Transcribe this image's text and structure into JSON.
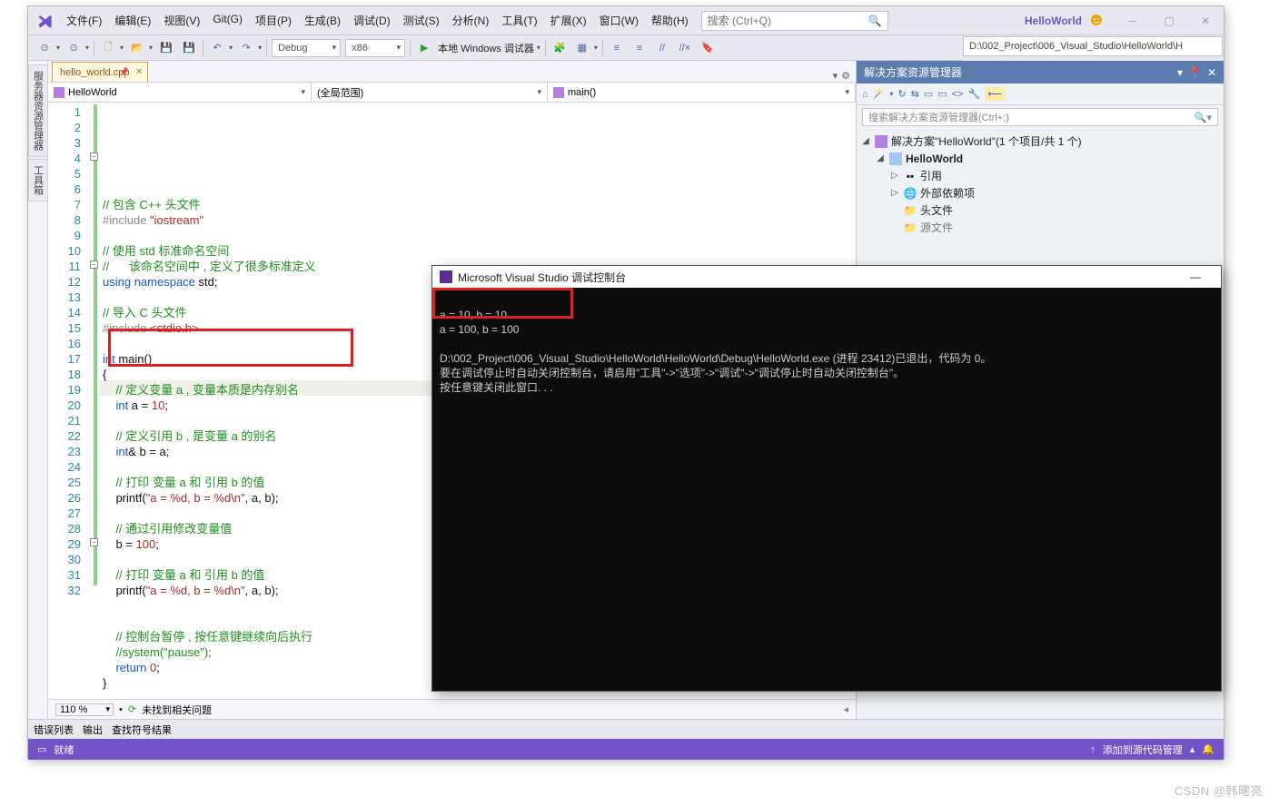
{
  "title_project": "HelloWorld",
  "path_display": "D:\\002_Project\\006_Visual_Studio\\HelloWorld\\H",
  "menus": [
    "文件(F)",
    "编辑(E)",
    "视图(V)",
    "Git(G)",
    "项目(P)",
    "生成(B)",
    "调试(D)",
    "测试(S)",
    "分析(N)",
    "工具(T)",
    "扩展(X)",
    "窗口(W)",
    "帮助(H)"
  ],
  "search_placeholder": "搜索 (Ctrl+Q)",
  "config_combo": "Debug",
  "platform_combo": "x86",
  "run_label": "本地 Windows 调试器",
  "file_tab": "hello_world.cpp",
  "nav1": "HelloWorld",
  "nav2": "(全局范围)",
  "nav3": "main()",
  "sidetabs": [
    "服务器资源管理器",
    "工具箱"
  ],
  "code_lines": [
    "// 包含 C++ 头文件",
    "#include \"iostream\"",
    "",
    "// 使用 std 标准命名空间",
    "//      该命名空间中 , 定义了很多标准定义",
    "using namespace std;",
    "",
    "// 导入 C 头文件",
    "#include <stdio.h>",
    "",
    "int main()",
    "{",
    "    // 定义变量 a , 变量本质是内存别名",
    "    int a = 10;",
    "",
    "    // 定义引用 b , 是变量 a 的别名",
    "    int& b = a;",
    "",
    "    // 打印 变量 a 和 引用 b 的值",
    "    printf(\"a = %d, b = %d\\n\", a, b);",
    "",
    "    // 通过引用修改变量值",
    "    b = 100;",
    "",
    "    // 打印 变量 a 和 引用 b 的值",
    "    printf(\"a = %d, b = %d\\n\", a, b);",
    "",
    "",
    "    // 控制台暂停 , 按任意键继续向后执行",
    "    //system(\"pause\");",
    "    return 0;",
    "}"
  ],
  "zoom": "110 %",
  "issue_text": "未找到相关问题",
  "bottom_tabs": [
    "错误列表",
    "输出",
    "查找符号结果"
  ],
  "status_text": "就绪",
  "status_right": "添加到源代码管理",
  "solution": {
    "title": "解决方案资源管理器",
    "search_placeholder": "搜索解决方案资源管理器(Ctrl+;)",
    "root": "解决方案\"HelloWorld\"(1 个项目/共 1 个)",
    "project": "HelloWorld",
    "nodes": [
      "引用",
      "外部依赖项",
      "头文件",
      "源文件"
    ]
  },
  "console": {
    "title": "Microsoft Visual Studio 调试控制台",
    "out1": "a = 10, b = 10",
    "out2": "a = 100, b = 100",
    "exit": "D:\\002_Project\\006_Visual_Studio\\HelloWorld\\HelloWorld\\Debug\\HelloWorld.exe (进程 23412)已退出，代码为 0。",
    "hint1": "要在调试停止时自动关闭控制台，请启用\"工具\"->\"选项\"->\"调试\"->\"调试停止时自动关闭控制台\"。",
    "hint2": "按任意键关闭此窗口. . ."
  },
  "watermark": "CSDN @韩曙亮"
}
